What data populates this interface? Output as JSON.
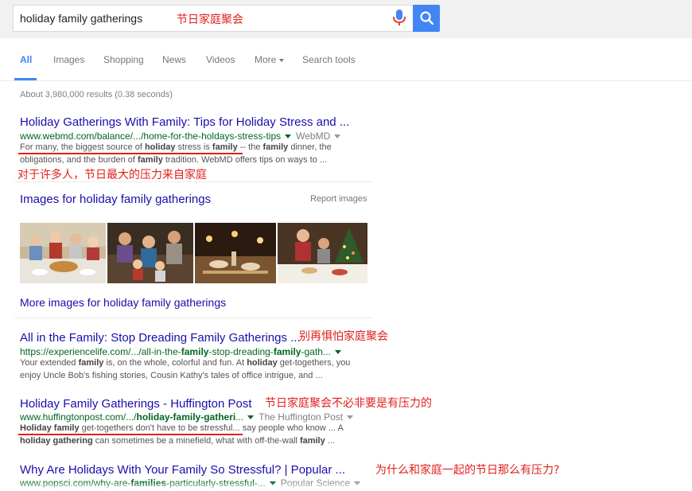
{
  "search": {
    "query": "holiday family gatherings",
    "annotation": "节日家庭聚会"
  },
  "nav": {
    "items": [
      "All",
      "Images",
      "Shopping",
      "News",
      "Videos",
      "More",
      "Search tools"
    ]
  },
  "stats": "About 3,980,000 results (0.38 seconds)",
  "results": [
    {
      "title": "Holiday Gatherings With Family: Tips for Holiday Stress and ...",
      "url_pre": "www.webmd.com/balance/.../home-for-the-holdays-stress-tips",
      "source": "WebMD",
      "s1_a": "For many, the biggest source of ",
      "s1_b": "holiday",
      "s1_c": " stress is ",
      "s1_d": "family",
      "s1_e": " -- the ",
      "s1_f": "family",
      "s1_g": " dinner, the",
      "s2_a": "obligations, and the burden of ",
      "s2_b": "family",
      "s2_c": " tradition. WebMD offers tips on ways to ...",
      "annotation": "对于许多人，节日最大的压力来自家庭"
    },
    {
      "title": "All in the Family: Stop Dreading Family Gatherings ...",
      "url_a": "https://experiencelife.com/.../all-in-the-",
      "url_b": "family",
      "url_c": "-stop-dreading-",
      "url_d": "family",
      "url_e": "-gath...",
      "s1_a": "Your extended ",
      "s1_b": "family",
      "s1_c": " is, on the whole, colorful and fun. At ",
      "s1_d": "holiday",
      "s1_e": " get-togethers, you",
      "s2": "enjoy Uncle Bob's fishing stories, Cousin Kathy's tales of office intrigue, and  ...",
      "annotation": "别再惧怕家庭聚会"
    },
    {
      "title": "Holiday Family Gatherings - Huffington Post",
      "url_a": "www.huffingtonpost.com/.../",
      "url_b": "holiday-family-gatheri",
      "url_c": "...",
      "source": "The Huffington Post",
      "s1_a": "Holiday family",
      "s1_b": " get-togethers don't have to be stressful...",
      "s1_c": " say people who know ... A",
      "s2_a": "holiday gathering",
      "s2_b": " can sometimes be a minefield, what with off-the-wall ",
      "s2_c": "family",
      "s2_d": " ...",
      "annotation": "节日家庭聚会不必非要是有压力的"
    },
    {
      "title": "Why Are Holidays With Your Family So Stressful? | Popular ...",
      "url_a": "www.popsci.com/why-are-",
      "url_b": "families",
      "url_c": "-particularly-stressful-...",
      "source": "Popular Science",
      "annotation": "为什么和家庭一起的节日那么有压力?"
    }
  ],
  "images_block": {
    "title": "Images for holiday family gatherings",
    "report": "Report images",
    "more": "More images for holiday family gatherings"
  },
  "colors": {
    "link": "#1a0dab",
    "url": "#006621",
    "accent": "#4285f4",
    "annotation": "#e0201c"
  }
}
